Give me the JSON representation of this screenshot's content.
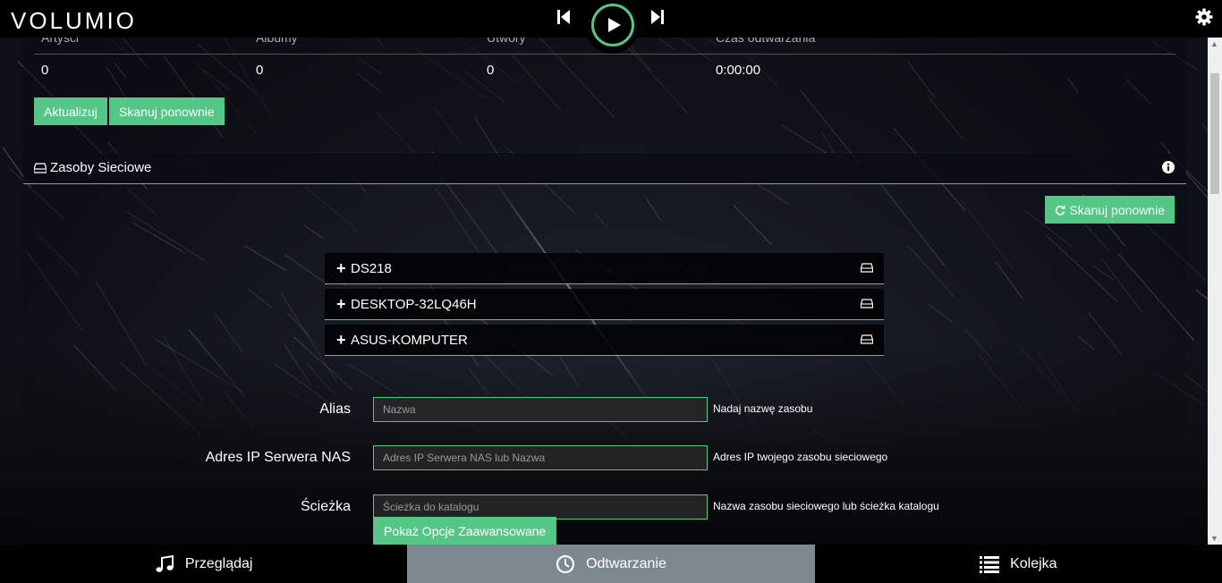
{
  "app": {
    "logo_text": "VOLUMIO"
  },
  "player": {
    "prev_icon": "skip-back-icon",
    "play_icon": "play-icon",
    "next_icon": "skip-forward-icon",
    "accent": "#54c686"
  },
  "stats": {
    "headers": [
      "Artyści",
      "Albumy",
      "Utwory",
      "Czas odtwarzania"
    ],
    "values": [
      "0",
      "0",
      "0",
      "0:00:00"
    ]
  },
  "library_buttons": {
    "update": "Aktualizuj",
    "rescan": "Skanuj ponownie"
  },
  "network": {
    "title": "Zasoby Sieciowe",
    "rescan_button": "Skanuj ponownie",
    "shares": [
      {
        "name": "DS218"
      },
      {
        "name": "DESKTOP-32LQ46H"
      },
      {
        "name": "ASUS-KOMPUTER"
      }
    ],
    "form": {
      "alias": {
        "label": "Alias",
        "placeholder": "Nazwa",
        "help": "Nadaj nazwę zasobu"
      },
      "ip": {
        "label": "Adres IP Serwera NAS",
        "placeholder": "Adres IP Serwera NAS lub Nazwa",
        "help": "Adres IP twojego zasobu sieciowego"
      },
      "path": {
        "label": "Ścieżka",
        "placeholder": "Ścieżka do katalogu",
        "help": "Nazwa zasobu sieciowego lub ścieżka katalogu"
      }
    },
    "advanced_button": "Pokaż Opcje Zaawansowane"
  },
  "bottom_tabs": [
    {
      "label": "Przeglądaj",
      "icon": "music-note-icon"
    },
    {
      "label": "Odtwarzanie",
      "icon": "clock-icon"
    },
    {
      "label": "Kolejka",
      "icon": "list-icon"
    }
  ]
}
